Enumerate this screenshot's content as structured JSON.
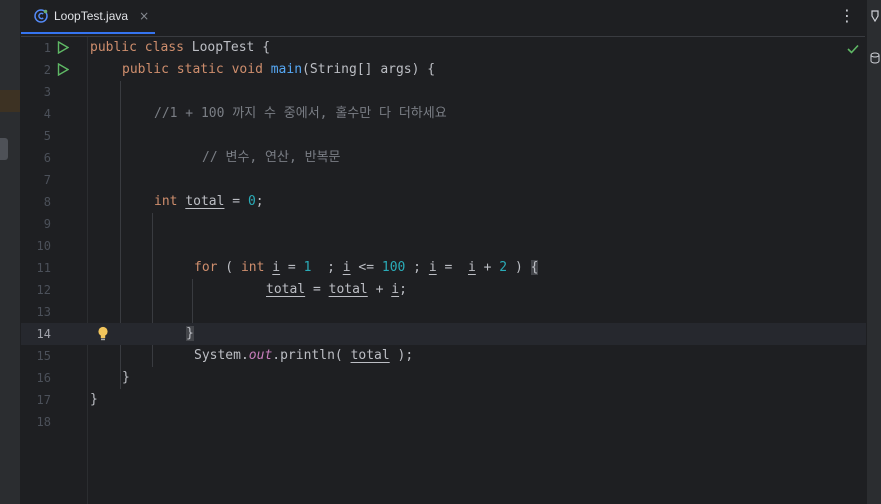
{
  "tab": {
    "filename": "LoopTest.java",
    "close_icon": "×",
    "more_icon": "⋮"
  },
  "gutter": {
    "line_numbers": [
      "1",
      "2",
      "3",
      "4",
      "5",
      "6",
      "7",
      "8",
      "9",
      "10",
      "11",
      "12",
      "13",
      "14",
      "15",
      "16",
      "17",
      "18"
    ]
  },
  "code": {
    "l1": {
      "kw1": "public",
      "kw2": "class",
      "rest": " LoopTest {"
    },
    "l2": {
      "kw1": "public",
      "kw2": "static",
      "kw3": "void",
      "fn": "main",
      "rest": "(String[] args) {"
    },
    "l4": "//1 + 100 까지 수 중에서, 홀수만 다 더하세요",
    "l6": "// 변수, 연산, 반복문",
    "l8": {
      "kw": "int",
      "var": "total",
      "eq": " = ",
      "num": "0",
      "end": ";"
    },
    "l11": {
      "kw_for": "for",
      "p1": " ( ",
      "kw_int": "int",
      "v1": "i",
      "p2": " = ",
      "n1": "1",
      "p3": "  ; ",
      "v2": "i",
      "p4": " <= ",
      "n2": "100",
      "p5": " ; ",
      "v3": "i",
      "p6": " =  ",
      "v4": "i",
      "p7": " + ",
      "n3": "2",
      "p8": " ) ",
      "brace": "{"
    },
    "l12": {
      "v1": "total",
      "p1": " = ",
      "v2": "total",
      "p2": " + ",
      "v3": "i",
      "end": ";"
    },
    "l14": "}",
    "l15": {
      "obj": "System.",
      "field": "out",
      "call": ".println( ",
      "var": "total",
      "end": " );"
    },
    "l16": "}",
    "l17": "}"
  },
  "status": {
    "inspection": "ok"
  },
  "colors": {
    "accent": "#3574f0",
    "keyword": "#cf8e6d",
    "function": "#56a8f5",
    "number": "#2aacb8",
    "comment": "#7a7e85",
    "static_field": "#c77dbb"
  }
}
